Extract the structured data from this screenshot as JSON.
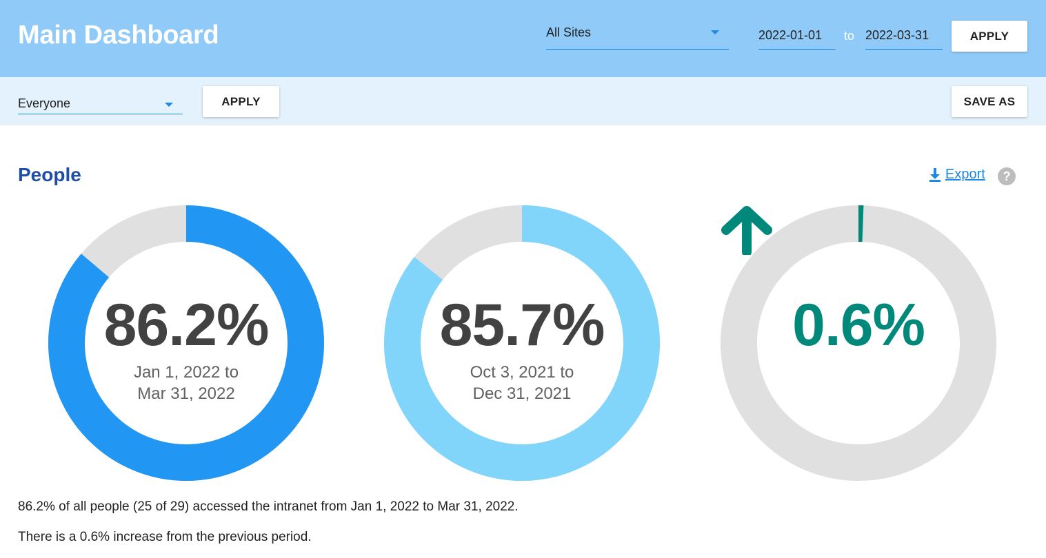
{
  "header": {
    "title": "Main Dashboard",
    "site_select": "All Sites",
    "date_from": "2022-01-01",
    "to_label": "to",
    "date_to": "2022-03-31",
    "apply_label": "APPLY"
  },
  "subbar": {
    "audience_select": "Everyone",
    "apply_label": "APPLY",
    "save_as_label": "SAVE AS"
  },
  "section": {
    "title": "People",
    "export_label": "Export",
    "help_glyph": "?"
  },
  "colors": {
    "current": "#2196f3",
    "previous": "#81d4fa",
    "change": "#00897b",
    "track": "#e0e0e0"
  },
  "metrics": {
    "current": {
      "value_label": "86.2%",
      "percent": 86.2,
      "range_line1": "Jan 1, 2022 to",
      "range_line2": "Mar 31, 2022"
    },
    "previous": {
      "value_label": "85.7%",
      "percent": 85.7,
      "range_line1": "Oct 3, 2021 to",
      "range_line2": "Dec 31, 2021"
    },
    "change": {
      "value_label": "0.6%",
      "percent": 0.6,
      "direction": "up",
      "icon": "arrow-up-icon"
    }
  },
  "summary": {
    "line1": "86.2% of all people (25 of 29) accessed the intranet from Jan 1, 2022 to Mar 31, 2022.",
    "line2": "There is a 0.6% increase from the previous period."
  }
}
